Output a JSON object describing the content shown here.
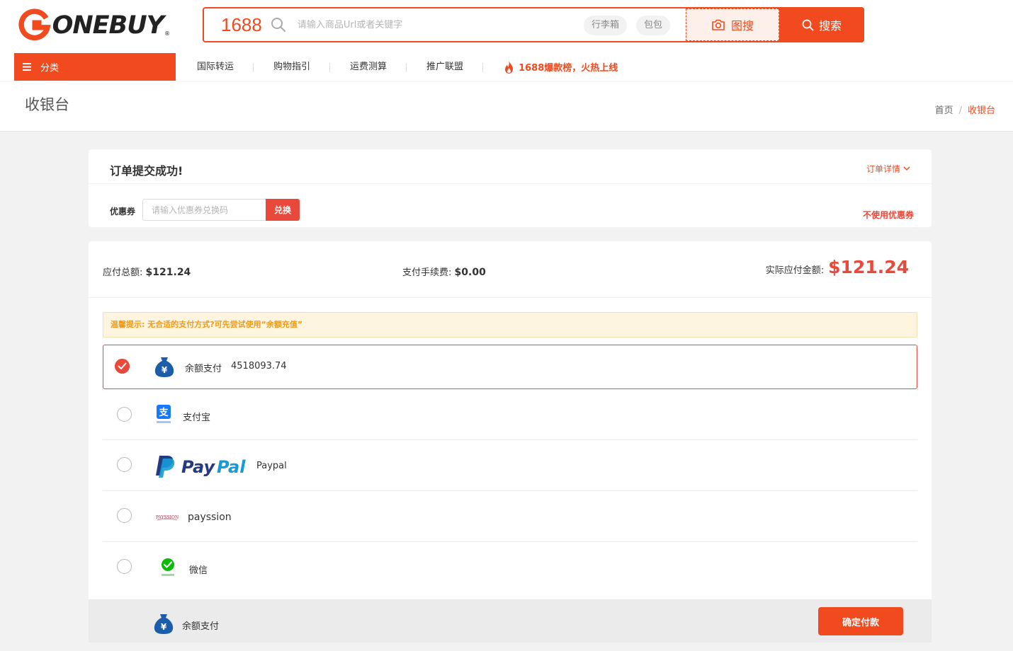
{
  "header": {
    "logo_text": "ONEBUY",
    "logo_reg": "®",
    "search": {
      "platform": "1688",
      "placeholder": "请输入商品Url或者关键字",
      "tags": [
        "行李箱",
        "包包"
      ],
      "image_search_label": "图搜",
      "search_button_label": "搜索"
    },
    "category_button_label": "分类",
    "nav": [
      "国际转运",
      "购物指引",
      "运费测算",
      "推广联盟"
    ],
    "hot_label": "1688爆款榜，火热上线"
  },
  "page": {
    "title": "收银台",
    "breadcrumb": {
      "home": "首页",
      "sep": "/",
      "current": "收银台"
    }
  },
  "order": {
    "title": "订单提交成功!",
    "detail_link": "订单详情",
    "coupon_label": "优惠券",
    "coupon_placeholder": "请输入优惠券兑换码",
    "coupon_button": "兑换",
    "no_coupon": "不使用优惠券"
  },
  "amounts": {
    "total_label": "应付总额:",
    "total_value": "$121.24",
    "fee_label": "支付手续费:",
    "fee_value": "$0.00",
    "actual_label": "实际应付金额:",
    "actual_value": "$121.24"
  },
  "payment": {
    "tip": "温馨提示: 无合适的支付方式?可先尝试使用“余额充值”",
    "methods": [
      {
        "label": "余额支付",
        "extra": "4518093.74",
        "selected": true,
        "icon": "money-bag-icon"
      },
      {
        "label": "支付宝",
        "extra": "",
        "selected": false,
        "icon": "alipay-icon"
      },
      {
        "label": "Paypal",
        "extra": "",
        "selected": false,
        "icon": "paypal-logo",
        "logo_text": "PayPal"
      },
      {
        "label": "payssion",
        "extra": "",
        "selected": false,
        "icon": "payssion-logo",
        "logo_text": "PAYSSION"
      },
      {
        "label": "微信",
        "extra": "",
        "selected": false,
        "icon": "wechat-pay-icon"
      }
    ],
    "footer_label": "余额支付",
    "confirm_button": "确定付款"
  },
  "colors": {
    "brand": "#f14a1e",
    "price_red": "#e8493b",
    "tip_orange": "#f09a1a",
    "paypal_dark": "#253b80",
    "paypal_light": "#179bd7",
    "alipay_blue": "#1677ff",
    "wechat_green": "#09bb07",
    "money_bag_blue": "#1b5cab"
  }
}
